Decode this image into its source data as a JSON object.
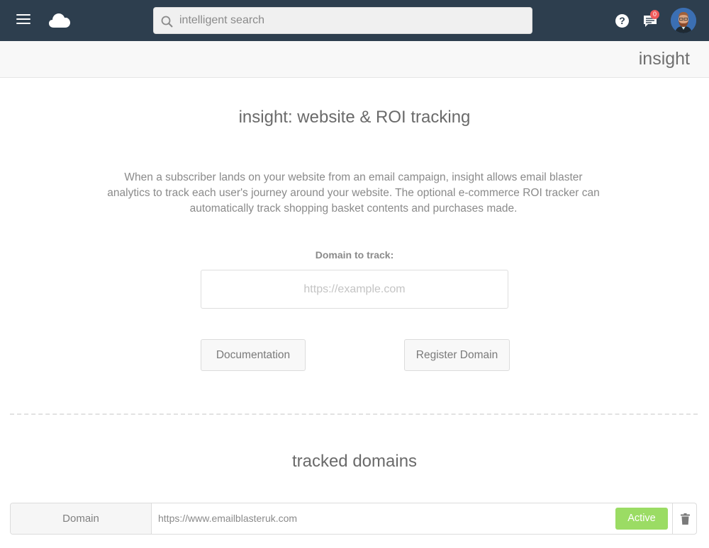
{
  "topbar": {
    "menu_icon": "hamburger-menu-icon",
    "logo_icon": "cloud-icon",
    "search": {
      "placeholder": "intelligent search",
      "value": "",
      "icon": "search-icon"
    },
    "help_icon": "question-circle-icon",
    "messages": {
      "icon": "chat-bubble-icon",
      "badge_count": "0"
    },
    "avatar": "user-avatar",
    "colors": {
      "background": "#2d3e4e",
      "badge": "#f05a5a"
    }
  },
  "subbar": {
    "section_title": "insight"
  },
  "main": {
    "title": "insight: website & ROI tracking",
    "description": "When a subscriber lands on your website from an email campaign, insight allows email blaster analytics to track each user's journey around your website. The optional e-commerce ROI tracker can automatically track shopping basket contents and purchases made.",
    "domain_label": "Domain to track:",
    "domain_input": {
      "placeholder": "https://example.com",
      "value": ""
    },
    "buttons": {
      "documentation": "Documentation",
      "register": "Register Domain"
    }
  },
  "tracked": {
    "title": "tracked domains",
    "rows": [
      {
        "label": "Domain",
        "url": "https://www.emailblasteruk.com",
        "status": "Active",
        "status_color": "#9bdc64",
        "delete_icon": "trash-icon"
      }
    ]
  }
}
